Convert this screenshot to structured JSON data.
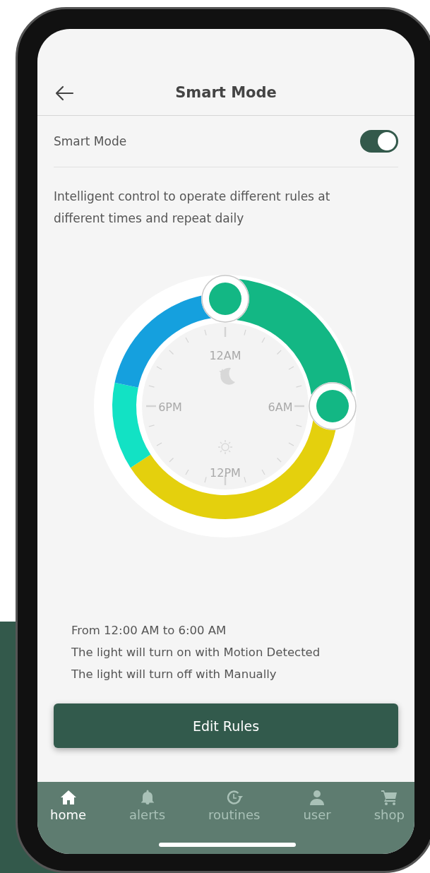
{
  "header": {
    "title": "Smart Mode"
  },
  "smart_mode": {
    "label": "Smart Mode",
    "on": true
  },
  "description": "Intelligent control to operate different rules at different times and repeat daily",
  "dial": {
    "labels": [
      "12AM",
      "6AM",
      "12PM",
      "6PM"
    ],
    "segments": [
      {
        "color": "#13b784"
      },
      {
        "color": "#e4d00d"
      },
      {
        "color": "#12e2c4"
      },
      {
        "color": "#15a0de"
      }
    ]
  },
  "summary": [
    "From 12:00 AM to 6:00 AM",
    "The light will turn on with Motion Detected",
    "The light will turn off with Manually"
  ],
  "button": "Edit Rules",
  "nav": [
    {
      "label": "home",
      "kind": "home",
      "selected": true
    },
    {
      "label": "alerts",
      "kind": "bell",
      "selected": false
    },
    {
      "label": "routines",
      "kind": "clock",
      "selected": false
    },
    {
      "label": "user",
      "kind": "user",
      "selected": false
    },
    {
      "label": "shop",
      "kind": "cart",
      "selected": false
    }
  ]
}
